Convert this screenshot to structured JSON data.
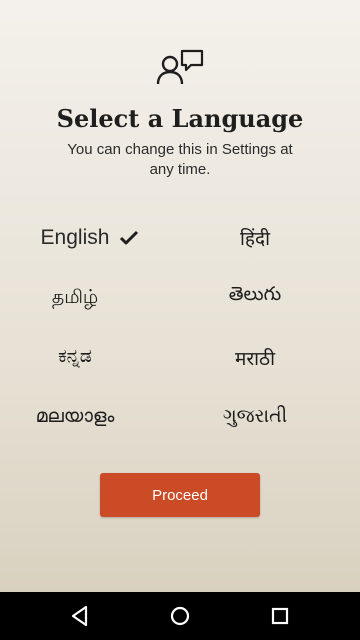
{
  "header": {
    "icon": "user-speech-bubble-icon",
    "title": "Select a Language",
    "subtitle": "You can change this in Settings at any time."
  },
  "languages": [
    {
      "label": "English",
      "selected": true
    },
    {
      "label": "हिंदी",
      "selected": false
    },
    {
      "label": "தமிழ்",
      "selected": false
    },
    {
      "label": "తెలుగు",
      "selected": false
    },
    {
      "label": "ಕನ್ನಡ",
      "selected": false
    },
    {
      "label": "मराठी",
      "selected": false
    },
    {
      "label": "മലയാളം",
      "selected": false
    },
    {
      "label": "ગુજરાતી",
      "selected": false
    }
  ],
  "actions": {
    "proceed_label": "Proceed"
  },
  "colors": {
    "accent": "#cb4b27",
    "text": "#1e1e1e",
    "navbar": "#000000"
  },
  "navbar": {
    "icons": [
      "back-triangle-icon",
      "home-circle-icon",
      "recents-square-icon"
    ]
  }
}
